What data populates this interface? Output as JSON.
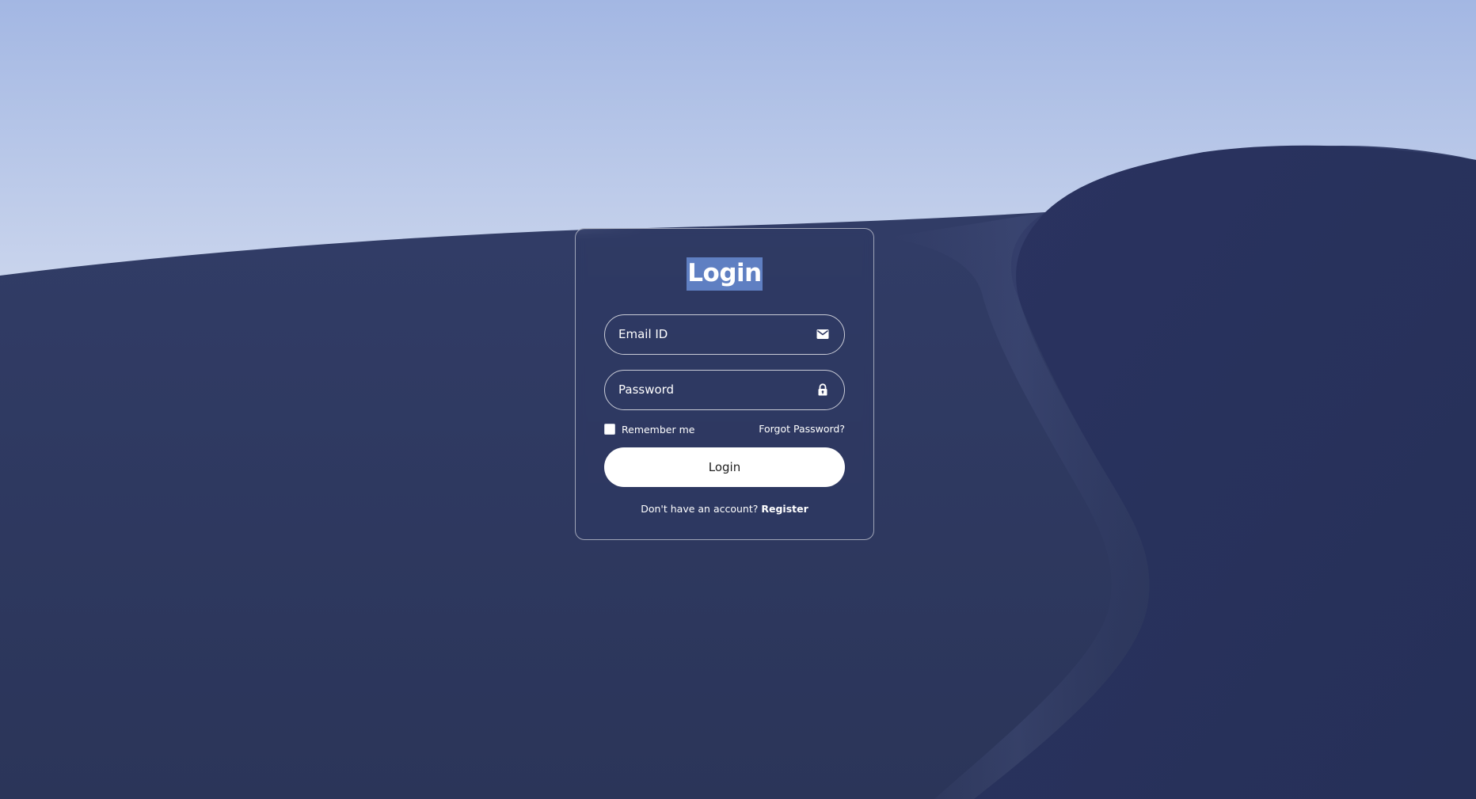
{
  "form": {
    "title": "Login",
    "email_placeholder": "Email ID",
    "password_placeholder": "Password",
    "remember_label": "Remember me",
    "forgot_label": "Forgot Password?",
    "login_button_label": "Login",
    "register_prompt": "Don't have an account?",
    "register_link": "Register"
  },
  "icons": {
    "email": "envelope-icon",
    "password": "lock-icon"
  },
  "colors": {
    "sky_top": "#a4b8e4",
    "sky_bottom": "#f4f6fa",
    "dune": "#2d375f",
    "title_highlight": "#5f7fc2",
    "button_bg": "#ffffff"
  }
}
